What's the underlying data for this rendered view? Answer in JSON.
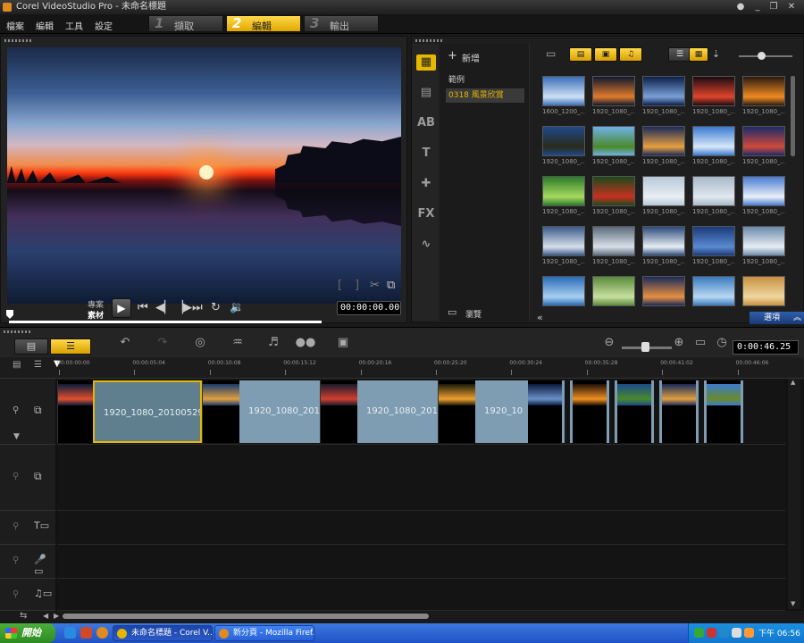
{
  "window": {
    "title": "Corel VideoStudio Pro - 未命名標題"
  },
  "menu": [
    "檔案",
    "編輯",
    "工具",
    "設定"
  ],
  "steps": [
    {
      "num": "1",
      "label": "擷取",
      "active": false
    },
    {
      "num": "2",
      "label": "編輯",
      "active": true
    },
    {
      "num": "3",
      "label": "輸出",
      "active": false
    }
  ],
  "preview": {
    "mode_project": "專案",
    "mode_clip": "素材",
    "timecode": "00:00:00.00",
    "scrub_position": 0,
    "icons": [
      "play-icon",
      "home-icon",
      "prev-frame-icon",
      "next-frame-icon",
      "end-icon",
      "repeat-icon",
      "volume-icon",
      "mark-in-icon",
      "mark-out-icon",
      "split-icon",
      "enlarge-icon"
    ]
  },
  "library": {
    "add_label": "新增",
    "folders": [
      "範例",
      "0318 風景欣賞"
    ],
    "selected_folder": "0318 風景欣賞",
    "browse_label": "瀏覽",
    "options_label": "選項",
    "thumbnails": [
      {
        "caption": "1600_1200_...",
        "colors": [
          "#3a6fb8",
          "#cfe0f5"
        ]
      },
      {
        "caption": "1920_1080_...",
        "colors": [
          "#101830",
          "#e07b2a"
        ]
      },
      {
        "caption": "1920_1080_...",
        "colors": [
          "#0b1f4a",
          "#7aa0d8"
        ]
      },
      {
        "caption": "1920_1080_...",
        "colors": [
          "#1a0a12",
          "#e0452a"
        ]
      },
      {
        "caption": "1920_1080_...",
        "colors": [
          "#2a1a10",
          "#f08a20"
        ]
      },
      {
        "caption": "1920_1080_...",
        "colors": [
          "#1f4a8a",
          "#2a2a1a"
        ]
      },
      {
        "caption": "1920_1080_...",
        "colors": [
          "#6fb0e8",
          "#4a8a2a"
        ]
      },
      {
        "caption": "1920_1080_...",
        "colors": [
          "#1a2a5a",
          "#e8a040"
        ]
      },
      {
        "caption": "1920_1080_...",
        "colors": [
          "#3a7ad0",
          "#d8e8f8"
        ]
      },
      {
        "caption": "1920_1080_...",
        "colors": [
          "#1a2a6a",
          "#d04a3a"
        ]
      },
      {
        "caption": "1920_1080_...",
        "colors": [
          "#2a7a2a",
          "#a8d860"
        ]
      },
      {
        "caption": "1920_1080_...",
        "colors": [
          "#1a4a1a",
          "#c83020"
        ]
      },
      {
        "caption": "1920_1080_...",
        "colors": [
          "#b8c8d8",
          "#e8eef4"
        ]
      },
      {
        "caption": "1920_1080_...",
        "colors": [
          "#a8b8c8",
          "#e0e8f0"
        ]
      },
      {
        "caption": "1920_1080_...",
        "colors": [
          "#4a7ad0",
          "#e8f0f8"
        ]
      },
      {
        "caption": "1920_1080_...",
        "colors": [
          "#3a5a8a",
          "#d8e0ec"
        ]
      },
      {
        "caption": "1920_1080_...",
        "colors": [
          "#5a6a7a",
          "#d8e0e8"
        ]
      },
      {
        "caption": "1920_1080_...",
        "colors": [
          "#2a4a7a",
          "#e8eef4"
        ]
      },
      {
        "caption": "1920_1080_...",
        "colors": [
          "#1a3a7a",
          "#5a8ad0"
        ]
      },
      {
        "caption": "1920_1080_...",
        "colors": [
          "#6a8aaa",
          "#e8eef4"
        ]
      },
      {
        "caption": "",
        "colors": [
          "#2a6ab8",
          "#a8d0f0"
        ]
      },
      {
        "caption": "",
        "colors": [
          "#5a8a3a",
          "#c8e0a0"
        ]
      },
      {
        "caption": "",
        "colors": [
          "#1a2a5a",
          "#e89040"
        ]
      },
      {
        "caption": "",
        "colors": [
          "#3a7ac0",
          "#b8d8f0"
        ]
      },
      {
        "caption": "",
        "colors": [
          "#c89040",
          "#f0d8a0"
        ]
      }
    ]
  },
  "timeline": {
    "total_time": "0:00:46.25",
    "ruler": [
      "00:00:00:00",
      "00:00:05:04",
      "00:00:10:08",
      "00:00:15:12",
      "00:00:20:16",
      "00:00:25:20",
      "00:00:30:24",
      "00:00:35:28",
      "00:00:41:02",
      "00:00:46:06"
    ],
    "title_clips": [
      {
        "label": "1920_1080_20100529",
        "selected": true
      },
      {
        "label": "1920_1080_201",
        "selected": false
      },
      {
        "label": "1920_1080_201",
        "selected": false
      },
      {
        "label": "1920_10",
        "selected": false
      }
    ],
    "video_clips": [
      {
        "colors": [
          "#0a1a3a",
          "#e05030"
        ]
      },
      {
        "colors": [
          "#1a3a6a",
          "#e0a040"
        ]
      },
      {
        "colors": [
          "#1a1a2a",
          "#d04030"
        ]
      },
      {
        "colors": [
          "#1a1a0a",
          "#f0a030"
        ]
      },
      {
        "colors": [
          "#0a1a3a",
          "#6a90c8"
        ]
      },
      {
        "colors": [
          "#201008",
          "#f09020"
        ]
      },
      {
        "colors": [
          "#1a4a8a",
          "#4a8a2a"
        ]
      },
      {
        "colors": [
          "#1a2a5a",
          "#e0a040"
        ]
      },
      {
        "colors": [
          "#3a7ad0",
          "#6a8a2a"
        ]
      }
    ]
  },
  "taskbar": {
    "start_label": "開始",
    "tasks": [
      {
        "label": "未命名標題 - Corel V...",
        "active": true
      },
      {
        "label": "新分頁 - Mozilla Firef...",
        "active": false
      }
    ],
    "clock": "下午 06:56"
  }
}
